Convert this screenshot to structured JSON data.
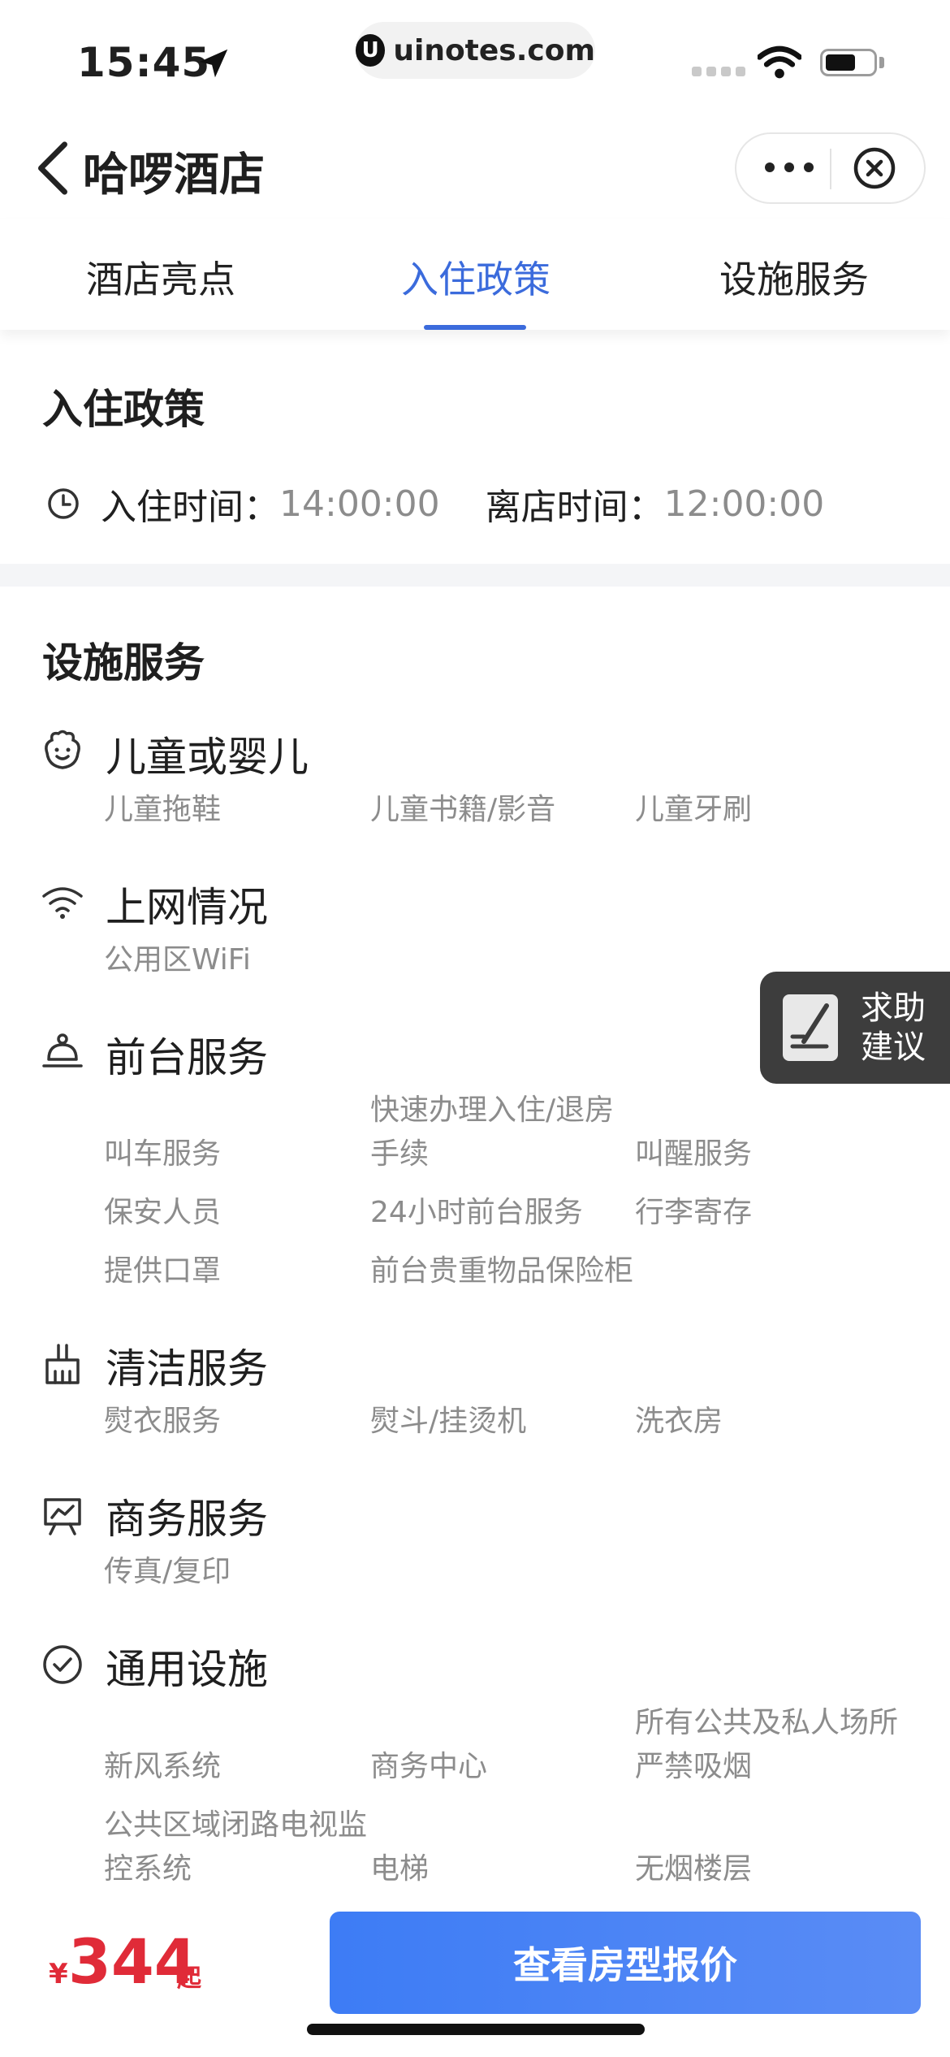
{
  "status_bar": {
    "time": "15:45",
    "url": "uinotes.com",
    "url_badge": "U"
  },
  "nav": {
    "title": "哈啰酒店"
  },
  "tabs": [
    {
      "label": "酒店亮点"
    },
    {
      "label": "入住政策"
    },
    {
      "label": "设施服务"
    }
  ],
  "policy": {
    "title": "入住政策",
    "checkin_label": "入住时间：",
    "checkin_value": "14:00:00",
    "checkout_label": "离店时间：",
    "checkout_value": "12:00:00"
  },
  "facilities": {
    "title": "设施服务",
    "categories": [
      {
        "name": "儿童或婴儿",
        "icon": "baby-face-icon",
        "items": [
          "儿童拖鞋",
          "儿童书籍/影音",
          "儿童牙刷"
        ]
      },
      {
        "name": "上网情况",
        "icon": "wifi-icon",
        "items": [
          "公用区WiFi"
        ]
      },
      {
        "name": "前台服务",
        "icon": "reception-bell-icon",
        "items": [
          "叫车服务",
          "快速办理入住/退房手续",
          "叫醒服务",
          "保安人员",
          "24小时前台服务",
          "行李寄存",
          "提供口罩",
          "前台贵重物品保险柜"
        ]
      },
      {
        "name": "清洁服务",
        "icon": "broom-icon",
        "items": [
          "熨衣服务",
          "熨斗/挂烫机",
          "洗衣房"
        ]
      },
      {
        "name": "商务服务",
        "icon": "presentation-board-icon",
        "items": [
          "传真/复印"
        ]
      },
      {
        "name": "通用设施",
        "icon": "check-circle-icon",
        "items": [
          "新风系统",
          "商务中心",
          "所有公共及私人场所严禁吸烟",
          "公共区域闭路电视监控系统",
          "电梯",
          "无烟楼层"
        ]
      }
    ]
  },
  "help": {
    "line1": "求助",
    "line2": "建议"
  },
  "bottom": {
    "currency": "¥",
    "price": "344",
    "suffix": "起",
    "cta": "查看房型报价"
  },
  "colors": {
    "accent": "#3b6bdc",
    "price": "#e02b38",
    "cta_start": "#3d7cf5",
    "cta_end": "#5a8cf5"
  }
}
